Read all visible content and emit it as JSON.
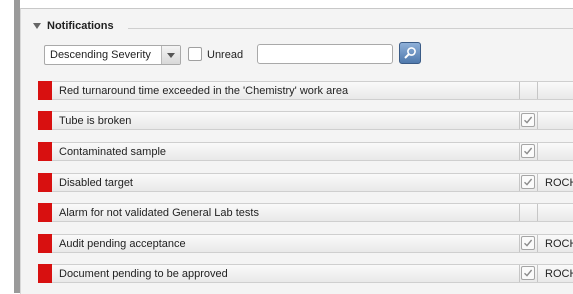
{
  "panel": {
    "title": "Notifications"
  },
  "filters": {
    "sort_selected": "Descending Severity",
    "unread_label": "Unread",
    "search_value": ""
  },
  "colors": {
    "severity_high": "#d81010",
    "search_button": "#4f79ad"
  },
  "notifications": [
    {
      "text": "Red turnaround time exceeded in the 'Chemistry' work area",
      "checked": false,
      "owner": ""
    },
    {
      "text": "Tube is broken",
      "checked": true,
      "owner": ""
    },
    {
      "text": "Contaminated sample",
      "checked": true,
      "owner": ""
    },
    {
      "text": "Disabled target",
      "checked": true,
      "owner": "ROCH"
    },
    {
      "text": "Alarm for not validated General Lab tests",
      "checked": false,
      "owner": ""
    },
    {
      "text": "Audit pending acceptance",
      "checked": true,
      "owner": "ROCH"
    },
    {
      "text": "Document pending to be approved",
      "checked": true,
      "owner": "ROCH"
    }
  ],
  "icons": {
    "collapse": "triangle-down-icon",
    "search": "search-icon",
    "check": "check-icon",
    "severity": "severity-indicator"
  }
}
